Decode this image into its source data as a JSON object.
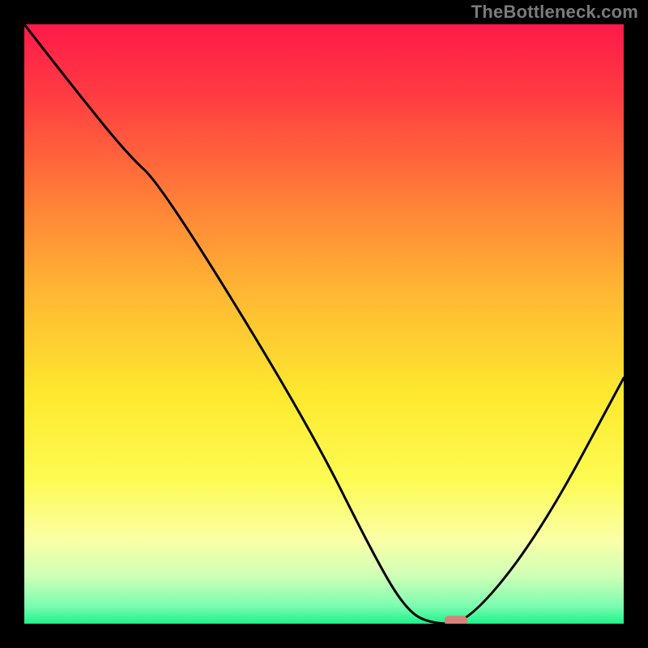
{
  "attribution": "TheBottleneck.com",
  "chart_data": {
    "type": "line",
    "title": "",
    "xlabel": "",
    "ylabel": "",
    "xlim": [
      0,
      100
    ],
    "ylim": [
      0,
      100
    ],
    "x": [
      0,
      7,
      17,
      23,
      47,
      59,
      64,
      68,
      74,
      86,
      100
    ],
    "values": [
      100,
      91,
      78.5,
      73,
      34,
      10,
      2,
      0,
      0,
      15,
      41
    ],
    "marker": {
      "x": 72,
      "y": 0.5,
      "color": "#d6817a"
    },
    "background_gradient_stops": [
      {
        "pct": 0,
        "color": "#ff1a4a"
      },
      {
        "pct": 12,
        "color": "#ff3c42"
      },
      {
        "pct": 28,
        "color": "#ff7a38"
      },
      {
        "pct": 45,
        "color": "#ffb833"
      },
      {
        "pct": 62,
        "color": "#fde92f"
      },
      {
        "pct": 76,
        "color": "#fdfb53"
      },
      {
        "pct": 86,
        "color": "#faffa6"
      },
      {
        "pct": 92,
        "color": "#cfffb7"
      },
      {
        "pct": 97,
        "color": "#7dfcb0"
      },
      {
        "pct": 100,
        "color": "#1ef28a"
      }
    ]
  }
}
